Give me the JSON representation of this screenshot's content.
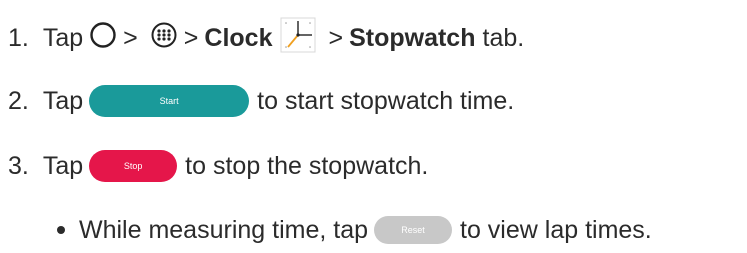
{
  "steps": [
    {
      "number": "1.",
      "tap": "Tap",
      "sep1": ">",
      "sep2": ">",
      "clock_label": "Clock",
      "sep3": ">",
      "stopwatch_label": "Stopwatch",
      "tab_label": "tab."
    },
    {
      "number": "2.",
      "tap": "Tap",
      "button_label": "Start",
      "rest": "to start stopwatch time."
    },
    {
      "number": "3.",
      "tap": "Tap",
      "button_label": "Stop",
      "rest": "to stop the stopwatch."
    }
  ],
  "bullet": {
    "lead": "While measuring time, tap",
    "button_label": "Reset",
    "rest": "to view lap times."
  },
  "colors": {
    "start_button": "#1a9a9a",
    "stop_button": "#e5164a",
    "reset_button": "#c8c8c8",
    "text": "#2b2b2b"
  },
  "icons": {
    "home": "home-circle-icon",
    "apps": "apps-grid-icon",
    "clock": "clock-app-icon"
  }
}
